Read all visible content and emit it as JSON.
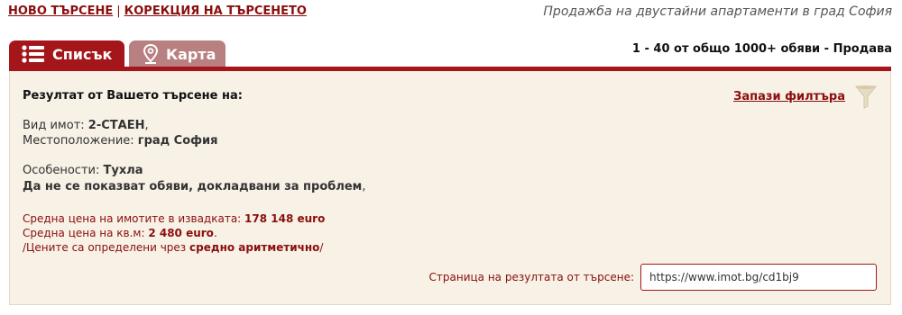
{
  "header": {
    "new_search": "НОВО ТЪРСЕНЕ",
    "separator": "|",
    "correct_search": "КОРЕКЦИЯ НА ТЪРСЕНЕТО",
    "subtitle": "Продажба на двустайни апартаменти в град София"
  },
  "tabs": {
    "list_label": "Списък",
    "list_icon": "list-icon",
    "map_label": "Карта",
    "map_icon": "map-pin-icon"
  },
  "results_count": "1 - 40 от общо 1000+ обяви - Продава",
  "summary": {
    "heading": "Резултат от Вашето търсене на:",
    "save_filter": "Запази филтъра",
    "filter_icon": "funnel-icon",
    "property_type_label": "Вид имот:",
    "property_type_value": "2-СТАЕН",
    "property_type_suffix": ",",
    "location_label": "Местоположение:",
    "location_value": "град София",
    "features_label": "Особености:",
    "features_value": "Тухла",
    "hide_reported": "Да не се показват обяви, докладвани за проблем",
    "hide_reported_suffix": ",",
    "avg_price_label": "Средна цена на имотите в извадката:",
    "avg_price_value": "178 148 euro",
    "avg_sqm_label": "Средна цена на кв.м:",
    "avg_sqm_value": "2 480 euro",
    "avg_sqm_suffix": ".",
    "method_prefix": "/Цените са определени чрез",
    "method_value": "средно аритметично",
    "method_suffix": "/"
  },
  "result_page": {
    "label": "Страница на резултата от търсене:",
    "url": "https://www.imot.bg/cd1bj9"
  },
  "colors": {
    "brand_red": "#a4161a",
    "inactive_tab": "#b88080",
    "panel_bg": "#f7f1e6",
    "link_red": "#8a0e0e"
  }
}
